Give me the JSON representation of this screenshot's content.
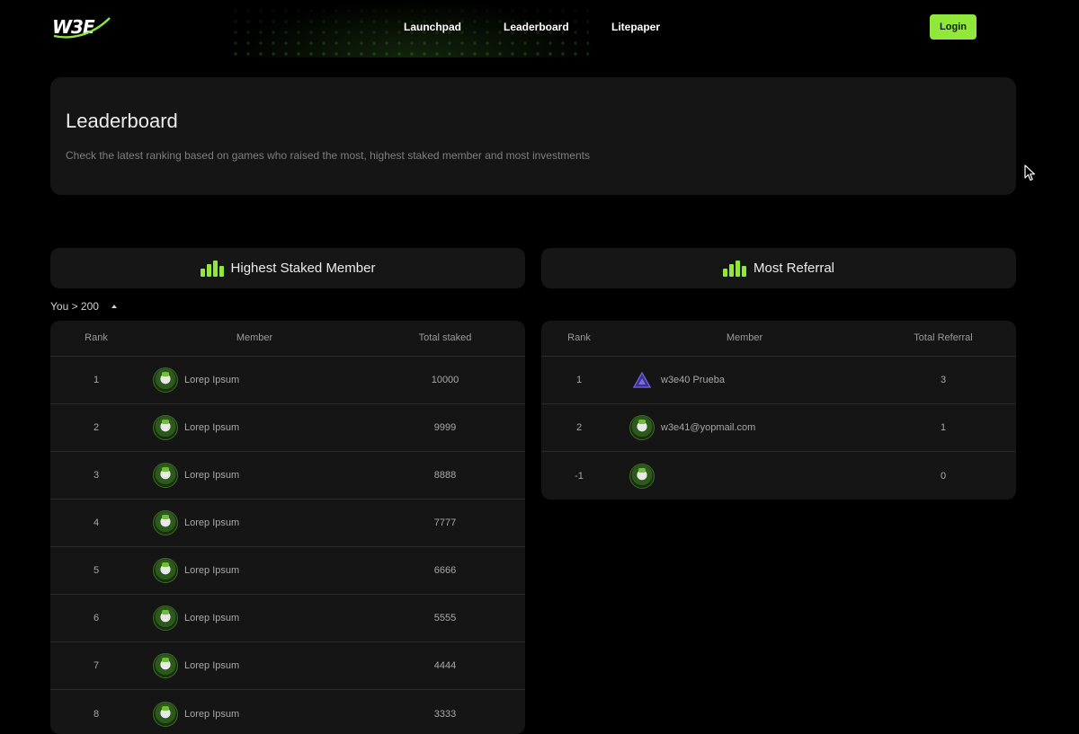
{
  "header": {
    "logo_text": "W3E",
    "nav": [
      "Launchpad",
      "Leaderboard",
      "Litepaper"
    ],
    "login_label": "Login"
  },
  "hero": {
    "title": "Leaderboard",
    "subtitle": "Check the latest ranking based on games who raised the most, highest staked member and most investments"
  },
  "staked": {
    "title": "Highest Staked Member",
    "icon": "bar-chart-icon",
    "you_label": "You > 200",
    "columns": [
      "Rank",
      "Member",
      "Total staked"
    ],
    "rows": [
      {
        "rank": "1",
        "member": "Lorep Ipsum",
        "value": "10000"
      },
      {
        "rank": "2",
        "member": "Lorep Ipsum",
        "value": "9999"
      },
      {
        "rank": "3",
        "member": "Lorep Ipsum",
        "value": "8888"
      },
      {
        "rank": "4",
        "member": "Lorep Ipsum",
        "value": "7777"
      },
      {
        "rank": "5",
        "member": "Lorep Ipsum",
        "value": "6666"
      },
      {
        "rank": "6",
        "member": "Lorep Ipsum",
        "value": "5555"
      },
      {
        "rank": "7",
        "member": "Lorep Ipsum",
        "value": "4444"
      },
      {
        "rank": "8",
        "member": "Lorep Ipsum",
        "value": "3333"
      }
    ]
  },
  "referral": {
    "title": "Most Referral",
    "icon": "bar-chart-icon",
    "columns": [
      "Rank",
      "Member",
      "Total Referral"
    ],
    "rows": [
      {
        "rank": "1",
        "member": "w3e40 Prueba",
        "value": "3",
        "avatar": "triangle-logo-icon"
      },
      {
        "rank": "2",
        "member": "w3e41@yopmail.com",
        "value": "1",
        "avatar": "avatar-icon"
      },
      {
        "rank": "-1",
        "member": "",
        "value": "0",
        "avatar": "avatar-icon"
      }
    ]
  },
  "colors": {
    "accent": "#8fe83a",
    "background": "#000000",
    "card": "#151515"
  }
}
